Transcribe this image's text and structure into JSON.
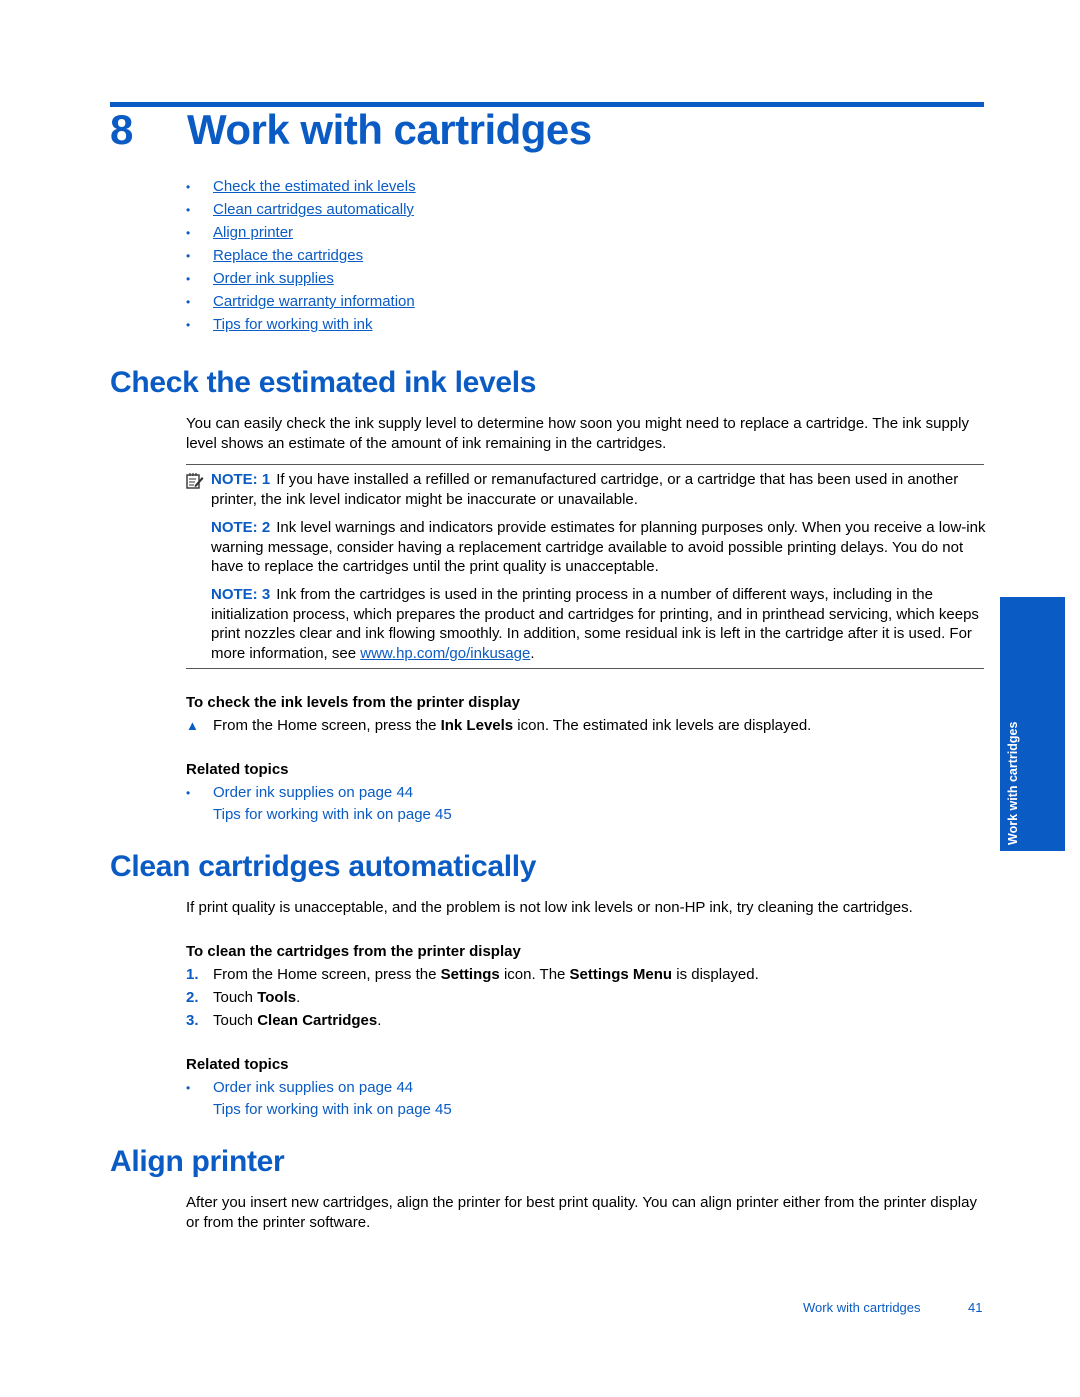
{
  "chapter": {
    "number": "8",
    "title": "Work with cartridges"
  },
  "toc": [
    "Check the estimated ink levels",
    "Clean cartridges automatically",
    "Align printer",
    "Replace the cartridges",
    "Order ink supplies",
    "Cartridge warranty information",
    "Tips for working with ink"
  ],
  "bullet_char": "•",
  "section_check": {
    "title": "Check the estimated ink levels",
    "intro": "You can easily check the ink supply level to determine how soon you might need to replace a cartridge. The ink supply level shows an estimate of the amount of ink remaining in the cartridges.",
    "notes": [
      {
        "label": "NOTE: 1",
        "text": "If you have installed a refilled or remanufactured cartridge, or a cartridge that has been used in another printer, the ink level indicator might be inaccurate or unavailable."
      },
      {
        "label": "NOTE: 2",
        "text": "Ink level warnings and indicators provide estimates for planning purposes only. When you receive a low-ink warning message, consider having a replacement cartridge available to avoid possible printing delays. You do not have to replace the cartridges until the print quality is unacceptable."
      },
      {
        "label": "NOTE: 3",
        "text": "Ink from the cartridges is used in the printing process in a number of different ways, including in the initialization process, which prepares the product and cartridges for printing, and in printhead servicing, which keeps print nozzles clear and ink flowing smoothly. In addition, some residual ink is left in the cartridge after it is used. For more information, see ",
        "link": "www.hp.com/go/inkusage",
        "after": "."
      }
    ],
    "procedure_title": "To check the ink levels from the printer display",
    "step": {
      "marker": "▲",
      "pre": "From the Home screen, press the ",
      "bold": "Ink Levels",
      "post": " icon. The estimated ink levels are displayed."
    },
    "related_title": "Related topics",
    "related": [
      "Order ink supplies on page 44",
      "Tips for working with ink on page 45"
    ]
  },
  "section_clean": {
    "title": "Clean cartridges automatically",
    "intro": "If print quality is unacceptable, and the problem is not low ink levels or non-HP ink, try cleaning the cartridges.",
    "procedure_title": "To clean the cartridges from the printer display",
    "steps": [
      {
        "marker": "1.",
        "parts": [
          "From the Home screen, press the ",
          "Settings",
          " icon. The ",
          "Settings Menu",
          " is displayed."
        ]
      },
      {
        "marker": "2.",
        "parts": [
          "Touch ",
          "Tools",
          "."
        ]
      },
      {
        "marker": "3.",
        "parts": [
          "Touch ",
          "Clean Cartridges",
          "."
        ]
      }
    ],
    "related_title": "Related topics",
    "related": [
      "Order ink supplies on page 44",
      "Tips for working with ink on page 45"
    ]
  },
  "section_align": {
    "title": "Align printer",
    "intro": "After you insert new cartridges, align the printer for best print quality. You can align printer either from the printer display or from the printer software."
  },
  "side_tab": "Work with cartridges",
  "footer": {
    "chapter": "Work with cartridges",
    "page": "41"
  },
  "colors": {
    "accent": "#0a5bc4"
  }
}
